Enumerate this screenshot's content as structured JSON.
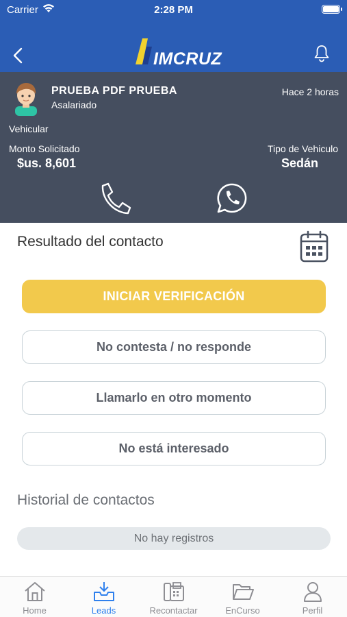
{
  "status_bar": {
    "carrier": "Carrier",
    "time": "2:28 PM"
  },
  "header": {
    "logo_text": "IMCRUZ"
  },
  "lead": {
    "name": "PRUEBA PDF PRUEBA",
    "employment": "Asalariado",
    "time_ago": "Hace 2 horas",
    "product": "Vehicular",
    "amount_label": "Monto Solicitado",
    "amount_value": "$us. 8,601",
    "vehicle_type_label": "Tipo de Vehiculo",
    "vehicle_type_value": "Sedán"
  },
  "result": {
    "title": "Resultado del contacto",
    "primary_button": "INICIAR VERIFICACIÓN",
    "options": [
      "No contesta / no responde",
      "Llamarlo en otro momento",
      "No está interesado"
    ]
  },
  "history": {
    "title": "Historial de contactos",
    "empty_text": "No hay registros"
  },
  "tabs": [
    {
      "label": "Home",
      "icon": "home-icon",
      "active": false
    },
    {
      "label": "Leads",
      "icon": "inbox-download-icon",
      "active": true
    },
    {
      "label": "Recontactar",
      "icon": "fax-phone-icon",
      "active": false
    },
    {
      "label": "EnCurso",
      "icon": "folder-open-icon",
      "active": false
    },
    {
      "label": "Perfil",
      "icon": "user-icon",
      "active": false
    }
  ],
  "colors": {
    "header_blue": "#2b5db5",
    "panel_dark": "#454e5f",
    "primary_yellow": "#f2c94c",
    "active_tab": "#2f80ed"
  }
}
